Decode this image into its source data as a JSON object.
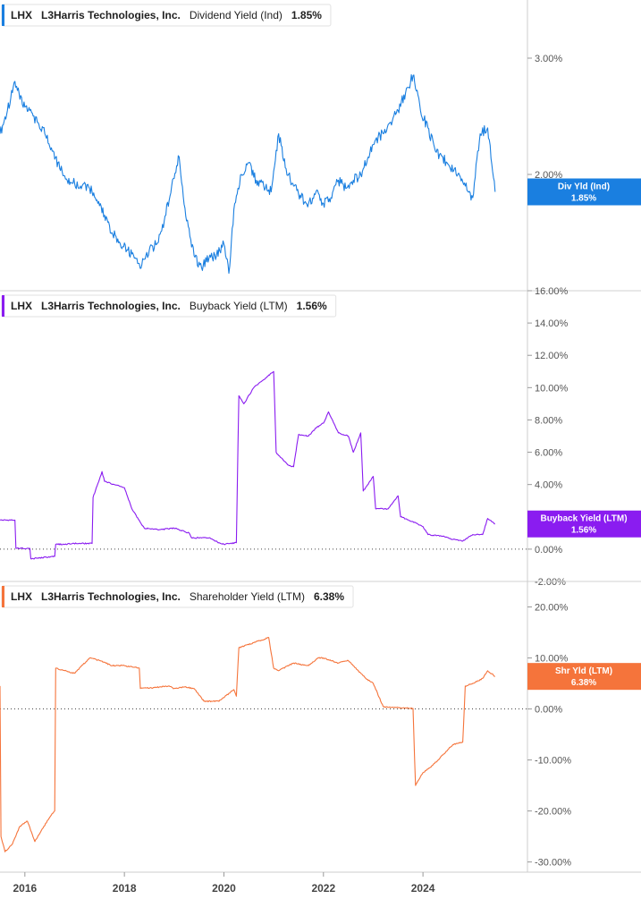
{
  "chart_data": [
    {
      "type": "line",
      "ticker": "LHX",
      "company": "L3Harris Technologies, Inc.",
      "metric": "Dividend Yield (Ind)",
      "current_value": "1.85%",
      "flag_label": "Div Yld (Ind)",
      "color": "#1a7fe0",
      "ylim": [
        1.0,
        3.5
      ],
      "yticks": [
        2.0,
        3.0
      ],
      "ytick_labels": [
        "2.00%",
        "3.00%"
      ],
      "zero_line": false,
      "x": [
        2015.5,
        2015.65,
        2015.8,
        2015.95,
        2016.1,
        2016.25,
        2016.4,
        2016.55,
        2016.7,
        2016.85,
        2017.0,
        2017.15,
        2017.3,
        2017.45,
        2017.6,
        2017.75,
        2017.9,
        2018.05,
        2018.2,
        2018.35,
        2018.5,
        2018.65,
        2018.8,
        2018.95,
        2019.1,
        2019.25,
        2019.4,
        2019.55,
        2019.7,
        2019.85,
        2020.0,
        2020.1,
        2020.2,
        2020.35,
        2020.5,
        2020.65,
        2020.8,
        2020.95,
        2021.1,
        2021.25,
        2021.4,
        2021.55,
        2021.7,
        2021.85,
        2022.0,
        2022.15,
        2022.3,
        2022.45,
        2022.6,
        2022.75,
        2022.9,
        2023.05,
        2023.2,
        2023.35,
        2023.5,
        2023.65,
        2023.8,
        2023.95,
        2024.1,
        2024.25,
        2024.4,
        2024.55,
        2024.7,
        2024.85,
        2025.0,
        2025.15,
        2025.3,
        2025.45
      ],
      "values": [
        2.35,
        2.55,
        2.8,
        2.6,
        2.55,
        2.45,
        2.35,
        2.2,
        2.05,
        1.95,
        1.92,
        1.9,
        1.88,
        1.78,
        1.65,
        1.5,
        1.42,
        1.35,
        1.28,
        1.22,
        1.35,
        1.4,
        1.6,
        1.9,
        2.15,
        1.6,
        1.3,
        1.2,
        1.28,
        1.3,
        1.4,
        1.15,
        1.7,
        2.0,
        2.1,
        1.95,
        1.9,
        1.85,
        2.35,
        2.05,
        1.9,
        1.8,
        1.75,
        1.85,
        1.75,
        1.8,
        1.95,
        1.88,
        1.95,
        2.0,
        2.15,
        2.3,
        2.35,
        2.45,
        2.55,
        2.7,
        2.85,
        2.55,
        2.4,
        2.2,
        2.15,
        2.05,
        2.0,
        1.9,
        1.8,
        2.35,
        2.4,
        1.85
      ]
    },
    {
      "type": "line",
      "ticker": "LHX",
      "company": "L3Harris Technologies, Inc.",
      "metric": "Buyback Yield (LTM)",
      "current_value": "1.56%",
      "flag_label": "Buyback Yield (LTM)",
      "color": "#8a1cf0",
      "ylim": [
        -2.0,
        16.0
      ],
      "yticks": [
        -2,
        0,
        2,
        4,
        6,
        8,
        10,
        12,
        14,
        16
      ],
      "ytick_labels": [
        "-2.00%",
        "0.00%",
        "2.00%",
        "4.00%",
        "6.00%",
        "8.00%",
        "10.00%",
        "12.00%",
        "14.00%",
        "16.00%"
      ],
      "zero_line": true,
      "x": [
        2015.5,
        2015.8,
        2015.82,
        2016.1,
        2016.12,
        2016.6,
        2016.62,
        2016.85,
        2016.87,
        2017.35,
        2017.37,
        2017.55,
        2017.6,
        2017.8,
        2018.0,
        2018.15,
        2018.35,
        2018.4,
        2018.7,
        2019.0,
        2019.3,
        2019.35,
        2019.7,
        2019.9,
        2020.0,
        2020.25,
        2020.3,
        2020.4,
        2020.6,
        2020.8,
        2021.0,
        2021.05,
        2021.1,
        2021.3,
        2021.4,
        2021.5,
        2021.7,
        2021.85,
        2022.0,
        2022.1,
        2022.3,
        2022.5,
        2022.6,
        2022.75,
        2022.8,
        2023.0,
        2023.05,
        2023.3,
        2023.5,
        2023.55,
        2023.8,
        2024.0,
        2024.1,
        2024.4,
        2024.6,
        2024.8,
        2025.0,
        2025.2,
        2025.3,
        2025.45
      ],
      "values": [
        1.8,
        1.8,
        0.05,
        0.05,
        -0.6,
        -0.45,
        0.3,
        0.3,
        0.35,
        0.35,
        3.2,
        4.8,
        4.2,
        4.0,
        3.8,
        2.5,
        1.5,
        1.3,
        1.2,
        1.3,
        1.0,
        0.7,
        0.7,
        0.4,
        0.3,
        0.4,
        9.5,
        9.0,
        10.0,
        10.5,
        11.0,
        6.0,
        5.8,
        5.2,
        5.1,
        7.1,
        7.0,
        7.5,
        7.8,
        8.5,
        7.2,
        7.0,
        6.0,
        7.2,
        3.6,
        4.5,
        2.5,
        2.5,
        3.3,
        2.0,
        1.7,
        1.4,
        0.9,
        0.8,
        0.6,
        0.5,
        0.9,
        0.9,
        1.9,
        1.56
      ]
    },
    {
      "type": "line",
      "ticker": "LHX",
      "company": "L3Harris Technologies, Inc.",
      "metric": "Shareholder Yield (LTM)",
      "current_value": "6.38%",
      "flag_label": "Shr Yld (LTM)",
      "color": "#f5743b",
      "ylim": [
        -32.0,
        25.0
      ],
      "yticks": [
        -30,
        -20,
        -10,
        0,
        10,
        20
      ],
      "ytick_labels": [
        "-30.00%",
        "-20.00%",
        "-10.00%",
        "0.00%",
        "10.00%",
        "20.00%"
      ],
      "zero_line": true,
      "x": [
        2015.5,
        2015.52,
        2015.6,
        2015.75,
        2015.9,
        2016.05,
        2016.2,
        2016.35,
        2016.55,
        2016.6,
        2016.62,
        2016.8,
        2017.0,
        2017.3,
        2017.5,
        2017.75,
        2018.0,
        2018.3,
        2018.32,
        2018.6,
        2018.9,
        2019.0,
        2019.2,
        2019.4,
        2019.6,
        2019.9,
        2020.2,
        2020.25,
        2020.3,
        2020.6,
        2020.9,
        2021.0,
        2021.1,
        2021.4,
        2021.7,
        2021.9,
        2022.0,
        2022.3,
        2022.5,
        2022.7,
        2022.85,
        2023.0,
        2023.2,
        2023.3,
        2023.4,
        2023.6,
        2023.8,
        2023.85,
        2024.0,
        2024.2,
        2024.4,
        2024.6,
        2024.8,
        2024.85,
        2025.0,
        2025.2,
        2025.3,
        2025.45
      ],
      "values": [
        4.5,
        -25.0,
        -28.0,
        -26.5,
        -23.0,
        -22.0,
        -26.0,
        -23.5,
        -20.5,
        -20.0,
        8.0,
        7.5,
        7.0,
        10.0,
        9.5,
        8.5,
        8.5,
        8.0,
        4.0,
        4.2,
        4.5,
        4.0,
        4.3,
        4.0,
        1.5,
        1.5,
        3.8,
        2.5,
        12.0,
        13.0,
        14.0,
        8.0,
        7.5,
        9.0,
        8.5,
        10.0,
        10.0,
        9.0,
        9.5,
        7.5,
        6.0,
        5.0,
        0.5,
        0.3,
        0.3,
        0.2,
        0.1,
        -15.0,
        -12.5,
        -11.0,
        -9.0,
        -7.0,
        -6.5,
        4.5,
        5.0,
        6.0,
        7.5,
        6.38
      ]
    }
  ],
  "x_axis": {
    "range": [
      2015.5,
      2026.1
    ],
    "ticks": [
      2016,
      2018,
      2020,
      2022,
      2024
    ],
    "tick_labels": [
      "2016",
      "2018",
      "2020",
      "2022",
      "2024"
    ]
  }
}
